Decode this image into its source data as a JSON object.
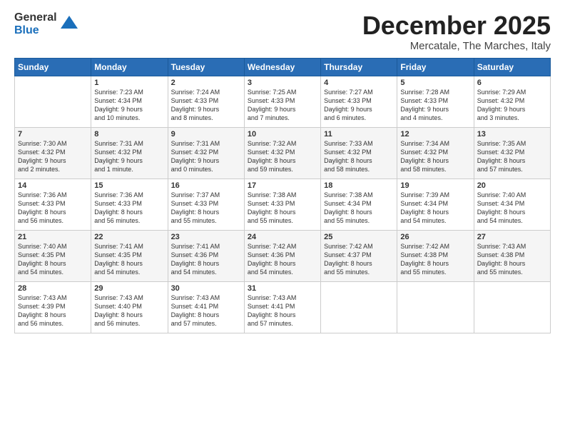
{
  "header": {
    "logo_general": "General",
    "logo_blue": "Blue",
    "month": "December 2025",
    "location": "Mercatale, The Marches, Italy"
  },
  "days_of_week": [
    "Sunday",
    "Monday",
    "Tuesday",
    "Wednesday",
    "Thursday",
    "Friday",
    "Saturday"
  ],
  "weeks": [
    [
      {
        "day": "",
        "info": ""
      },
      {
        "day": "1",
        "info": "Sunrise: 7:23 AM\nSunset: 4:34 PM\nDaylight: 9 hours\nand 10 minutes."
      },
      {
        "day": "2",
        "info": "Sunrise: 7:24 AM\nSunset: 4:33 PM\nDaylight: 9 hours\nand 8 minutes."
      },
      {
        "day": "3",
        "info": "Sunrise: 7:25 AM\nSunset: 4:33 PM\nDaylight: 9 hours\nand 7 minutes."
      },
      {
        "day": "4",
        "info": "Sunrise: 7:27 AM\nSunset: 4:33 PM\nDaylight: 9 hours\nand 6 minutes."
      },
      {
        "day": "5",
        "info": "Sunrise: 7:28 AM\nSunset: 4:33 PM\nDaylight: 9 hours\nand 4 minutes."
      },
      {
        "day": "6",
        "info": "Sunrise: 7:29 AM\nSunset: 4:32 PM\nDaylight: 9 hours\nand 3 minutes."
      }
    ],
    [
      {
        "day": "7",
        "info": "Sunrise: 7:30 AM\nSunset: 4:32 PM\nDaylight: 9 hours\nand 2 minutes."
      },
      {
        "day": "8",
        "info": "Sunrise: 7:31 AM\nSunset: 4:32 PM\nDaylight: 9 hours\nand 1 minute."
      },
      {
        "day": "9",
        "info": "Sunrise: 7:31 AM\nSunset: 4:32 PM\nDaylight: 9 hours\nand 0 minutes."
      },
      {
        "day": "10",
        "info": "Sunrise: 7:32 AM\nSunset: 4:32 PM\nDaylight: 8 hours\nand 59 minutes."
      },
      {
        "day": "11",
        "info": "Sunrise: 7:33 AM\nSunset: 4:32 PM\nDaylight: 8 hours\nand 58 minutes."
      },
      {
        "day": "12",
        "info": "Sunrise: 7:34 AM\nSunset: 4:32 PM\nDaylight: 8 hours\nand 58 minutes."
      },
      {
        "day": "13",
        "info": "Sunrise: 7:35 AM\nSunset: 4:32 PM\nDaylight: 8 hours\nand 57 minutes."
      }
    ],
    [
      {
        "day": "14",
        "info": "Sunrise: 7:36 AM\nSunset: 4:33 PM\nDaylight: 8 hours\nand 56 minutes."
      },
      {
        "day": "15",
        "info": "Sunrise: 7:36 AM\nSunset: 4:33 PM\nDaylight: 8 hours\nand 56 minutes."
      },
      {
        "day": "16",
        "info": "Sunrise: 7:37 AM\nSunset: 4:33 PM\nDaylight: 8 hours\nand 55 minutes."
      },
      {
        "day": "17",
        "info": "Sunrise: 7:38 AM\nSunset: 4:33 PM\nDaylight: 8 hours\nand 55 minutes."
      },
      {
        "day": "18",
        "info": "Sunrise: 7:38 AM\nSunset: 4:34 PM\nDaylight: 8 hours\nand 55 minutes."
      },
      {
        "day": "19",
        "info": "Sunrise: 7:39 AM\nSunset: 4:34 PM\nDaylight: 8 hours\nand 54 minutes."
      },
      {
        "day": "20",
        "info": "Sunrise: 7:40 AM\nSunset: 4:34 PM\nDaylight: 8 hours\nand 54 minutes."
      }
    ],
    [
      {
        "day": "21",
        "info": "Sunrise: 7:40 AM\nSunset: 4:35 PM\nDaylight: 8 hours\nand 54 minutes."
      },
      {
        "day": "22",
        "info": "Sunrise: 7:41 AM\nSunset: 4:35 PM\nDaylight: 8 hours\nand 54 minutes."
      },
      {
        "day": "23",
        "info": "Sunrise: 7:41 AM\nSunset: 4:36 PM\nDaylight: 8 hours\nand 54 minutes."
      },
      {
        "day": "24",
        "info": "Sunrise: 7:42 AM\nSunset: 4:36 PM\nDaylight: 8 hours\nand 54 minutes."
      },
      {
        "day": "25",
        "info": "Sunrise: 7:42 AM\nSunset: 4:37 PM\nDaylight: 8 hours\nand 55 minutes."
      },
      {
        "day": "26",
        "info": "Sunrise: 7:42 AM\nSunset: 4:38 PM\nDaylight: 8 hours\nand 55 minutes."
      },
      {
        "day": "27",
        "info": "Sunrise: 7:43 AM\nSunset: 4:38 PM\nDaylight: 8 hours\nand 55 minutes."
      }
    ],
    [
      {
        "day": "28",
        "info": "Sunrise: 7:43 AM\nSunset: 4:39 PM\nDaylight: 8 hours\nand 56 minutes."
      },
      {
        "day": "29",
        "info": "Sunrise: 7:43 AM\nSunset: 4:40 PM\nDaylight: 8 hours\nand 56 minutes."
      },
      {
        "day": "30",
        "info": "Sunrise: 7:43 AM\nSunset: 4:41 PM\nDaylight: 8 hours\nand 57 minutes."
      },
      {
        "day": "31",
        "info": "Sunrise: 7:43 AM\nSunset: 4:41 PM\nDaylight: 8 hours\nand 57 minutes."
      },
      {
        "day": "",
        "info": ""
      },
      {
        "day": "",
        "info": ""
      },
      {
        "day": "",
        "info": ""
      }
    ]
  ]
}
